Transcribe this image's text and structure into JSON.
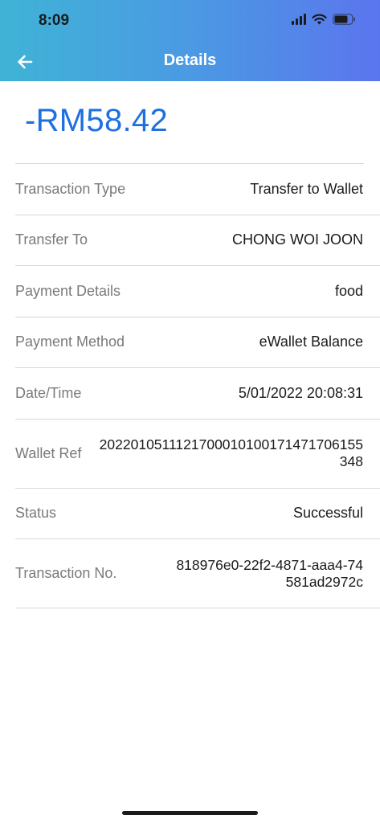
{
  "status_bar": {
    "time": "8:09"
  },
  "header": {
    "title": "Details",
    "back_icon": "arrow-left-icon"
  },
  "amount": "-RM58.42",
  "details": [
    {
      "label": "Transaction Type",
      "value": "Transfer to Wallet"
    },
    {
      "label": "Transfer To",
      "value": "CHONG WOI JOON"
    },
    {
      "label": "Payment Details",
      "value": "food"
    },
    {
      "label": "Payment Method",
      "value": "eWallet Balance"
    },
    {
      "label": "Date/Time",
      "value": "5/01/2022 20:08:31"
    },
    {
      "label": "Wallet Ref",
      "value": "2022010511121700010100171471706155348"
    },
    {
      "label": "Status",
      "value": "Successful"
    },
    {
      "label": "Transaction No.",
      "value": "818976e0-22f2-4871-aaa4-74581ad2972c"
    }
  ],
  "colors": {
    "header_gradient_start": "#3fb3d6",
    "header_gradient_end": "#5b75ee",
    "amount": "#1e6fe0"
  }
}
